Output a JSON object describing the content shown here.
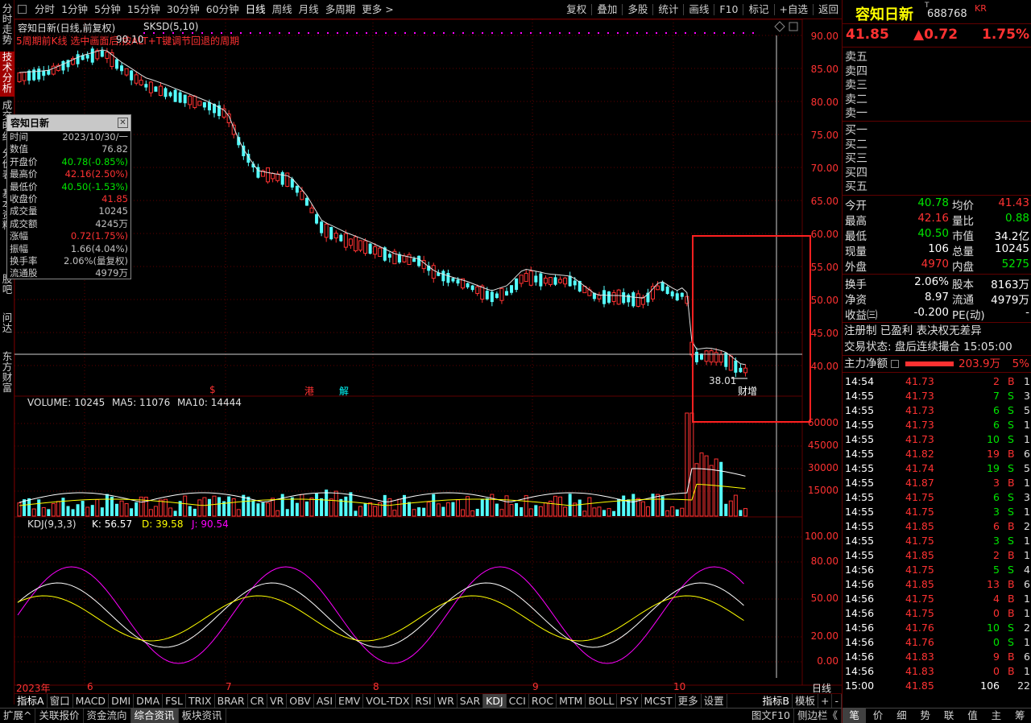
{
  "left_tabs": [
    "分时走势",
    "技术分析",
    "成交明细",
    "分价表",
    "基本资料",
    "股吧",
    "问达",
    "东方财富"
  ],
  "toolbar": {
    "periods": [
      "分时",
      "1分钟",
      "5分钟",
      "15分钟",
      "30分钟",
      "60分钟",
      "日线",
      "周线",
      "月线",
      "多周期",
      "更多"
    ],
    "active_period": "日线",
    "right_buttons": [
      "复权",
      "叠加",
      "多股",
      "统计",
      "画线",
      "F10",
      "标记",
      "+自选",
      "返回"
    ]
  },
  "chart": {
    "title": "容知日新(日线,前复权)",
    "indicator": "SKSD(5,10)",
    "hint": "5周期前K线 选中画面后,按ALT+T键调节回退的周期",
    "price_axis": [
      "90.00",
      "85.00",
      "80.00",
      "75.00",
      "70.00",
      "65.00",
      "60.00",
      "55.00",
      "50.00",
      "45.00",
      "40.00"
    ],
    "high_marker": "90.10",
    "low_marker": "38.01",
    "event_labels": [
      "$",
      "港",
      "解"
    ],
    "event_label_right": "财增",
    "volume_label": "VOLUME: 10245",
    "ma5_label": "MA5: 11076",
    "ma10_label": "MA10: 14444",
    "volume_axis": [
      "60000",
      "45000",
      "30000",
      "15000"
    ],
    "kdj_label": "KDJ(9,3,3)",
    "kdj_k": "K: 56.57",
    "kdj_d": "D: 39.58",
    "kdj_j": "J: 90.54",
    "kdj_axis": [
      "100.00",
      "80.00",
      "50.00",
      "20.00",
      "0.00"
    ],
    "time_axis": [
      "2023年",
      "6",
      "7",
      "8",
      "9",
      "10"
    ],
    "time_axis_right": "日线"
  },
  "infobox": {
    "title": "容知日新",
    "rows": [
      {
        "k": "时间",
        "v": "2023/10/30/一",
        "c": "gray"
      },
      {
        "k": "数值",
        "v": "76.82",
        "c": "gray"
      },
      {
        "k": "开盘价",
        "v": "40.78(-0.85%)",
        "c": "green"
      },
      {
        "k": "最高价",
        "v": "42.16(2.50%)",
        "c": "red"
      },
      {
        "k": "最低价",
        "v": "40.50(-1.53%)",
        "c": "green"
      },
      {
        "k": "收盘价",
        "v": "41.85",
        "c": "red"
      },
      {
        "k": "成交量",
        "v": "10245",
        "c": "gray"
      },
      {
        "k": "成交额",
        "v": "4245万",
        "c": "gray"
      },
      {
        "k": "涨幅",
        "v": "0.72(1.75%)",
        "c": "red"
      },
      {
        "k": "振幅",
        "v": "1.66(4.04%)",
        "c": "gray"
      },
      {
        "k": "换手率",
        "v": "2.06%(量复权)",
        "c": "gray"
      },
      {
        "k": "流通股",
        "v": "4979万",
        "c": "gray"
      }
    ]
  },
  "bottom_tabs": [
    "指标A",
    "窗口",
    "MACD",
    "DMI",
    "DMA",
    "FSL",
    "TRIX",
    "BRAR",
    "CR",
    "VR",
    "OBV",
    "ASI",
    "EMV",
    "VOL-TDX",
    "RSI",
    "WR",
    "SAR",
    "KDJ",
    "CCI",
    "ROC",
    "MTM",
    "BOLL",
    "PSY",
    "MCST",
    "更多",
    "设置",
    "指标B",
    "模板",
    "+",
    "-"
  ],
  "active_bottom_tab": "KDJ",
  "status_bar": [
    "扩展^",
    "关联报价",
    "资金流向",
    "综合资讯",
    "板块资讯"
  ],
  "status_right": [
    "图文F10",
    "侧边栏《"
  ],
  "quote": {
    "name": "容知日新",
    "code": "688768",
    "tag": "KR",
    "price": "41.85",
    "change": "▲0.72",
    "pct": "1.75%",
    "sell_labels": [
      "卖五",
      "卖四",
      "卖三",
      "卖二",
      "卖一"
    ],
    "buy_labels": [
      "买一",
      "买二",
      "买三",
      "买四",
      "买五"
    ],
    "stats": [
      {
        "k1": "今开",
        "v1": "40.78",
        "c1": "green",
        "k2": "均价",
        "v2": "41.43",
        "c2": "red"
      },
      {
        "k1": "最高",
        "v1": "42.16",
        "c1": "red",
        "k2": "量比",
        "v2": "0.88",
        "c2": "green"
      },
      {
        "k1": "最低",
        "v1": "40.50",
        "c1": "green",
        "k2": "市值",
        "v2": "34.2亿",
        "c2": "white"
      },
      {
        "k1": "现量",
        "v1": "106",
        "c1": "white",
        "k2": "总量",
        "v2": "10245",
        "c2": "white"
      },
      {
        "k1": "外盘",
        "v1": "4970",
        "c1": "red",
        "k2": "内盘",
        "v2": "5275",
        "c2": "green"
      }
    ],
    "stats2": [
      {
        "k1": "换手",
        "v1": "2.06%",
        "k2": "股本",
        "v2": "8163万"
      },
      {
        "k1": "净资",
        "v1": "8.97",
        "k2": "流通",
        "v2": "4979万"
      },
      {
        "k1": "收益㈢",
        "v1": "-0.200",
        "k2": "PE(动)",
        "v2": "-"
      }
    ],
    "register": "注册制 已盈利 表决权无差异",
    "trade_state": "交易状态: 盘后连续撮合 15:05:00",
    "main_net_label": "主力净额",
    "main_net_value": "203.9万",
    "main_net_pct": "5%",
    "ticks": [
      {
        "t": "14:54",
        "p": "41.73",
        "v": "2",
        "s": "B",
        "n": "1"
      },
      {
        "t": "14:55",
        "p": "41.73",
        "v": "7",
        "s": "S",
        "n": "3"
      },
      {
        "t": "14:55",
        "p": "41.73",
        "v": "6",
        "s": "S",
        "n": "5"
      },
      {
        "t": "14:55",
        "p": "41.73",
        "v": "6",
        "s": "S",
        "n": "1"
      },
      {
        "t": "14:55",
        "p": "41.73",
        "v": "10",
        "s": "S",
        "n": "1"
      },
      {
        "t": "14:55",
        "p": "41.82",
        "v": "19",
        "s": "B",
        "n": "6"
      },
      {
        "t": "14:55",
        "p": "41.74",
        "v": "19",
        "s": "S",
        "n": "5"
      },
      {
        "t": "14:55",
        "p": "41.87",
        "v": "3",
        "s": "B",
        "n": "1"
      },
      {
        "t": "14:55",
        "p": "41.75",
        "v": "6",
        "s": "S",
        "n": "3"
      },
      {
        "t": "14:55",
        "p": "41.75",
        "v": "3",
        "s": "S",
        "n": "1"
      },
      {
        "t": "14:55",
        "p": "41.85",
        "v": "6",
        "s": "B",
        "n": "2"
      },
      {
        "t": "14:55",
        "p": "41.75",
        "v": "3",
        "s": "S",
        "n": "1"
      },
      {
        "t": "14:55",
        "p": "41.85",
        "v": "2",
        "s": "B",
        "n": "1"
      },
      {
        "t": "14:56",
        "p": "41.75",
        "v": "5",
        "s": "S",
        "n": "4"
      },
      {
        "t": "14:56",
        "p": "41.85",
        "v": "13",
        "s": "B",
        "n": "6"
      },
      {
        "t": "14:56",
        "p": "41.75",
        "v": "4",
        "s": "B",
        "n": "1"
      },
      {
        "t": "14:56",
        "p": "41.75",
        "v": "0",
        "s": "B",
        "n": "1"
      },
      {
        "t": "14:56",
        "p": "41.76",
        "v": "10",
        "s": "S",
        "n": "2"
      },
      {
        "t": "14:56",
        "p": "41.76",
        "v": "0",
        "s": "S",
        "n": "1"
      },
      {
        "t": "14:56",
        "p": "41.83",
        "v": "9",
        "s": "B",
        "n": "6"
      },
      {
        "t": "14:56",
        "p": "41.83",
        "v": "0",
        "s": "B",
        "n": "1"
      },
      {
        "t": "15:00",
        "p": "41.85",
        "v": "106",
        "s": "",
        "n": "22"
      }
    ],
    "bottom_tabs": [
      "笔",
      "价",
      "细",
      "势",
      "联",
      "值",
      "主",
      "筹"
    ]
  },
  "colors": {
    "up": "#ff3232",
    "down": "#54ffff",
    "bg": "#000000",
    "grid": "#600000",
    "kdj_k": "#ffffff",
    "kdj_d": "#ffff00",
    "kdj_j": "#ff00ff"
  }
}
